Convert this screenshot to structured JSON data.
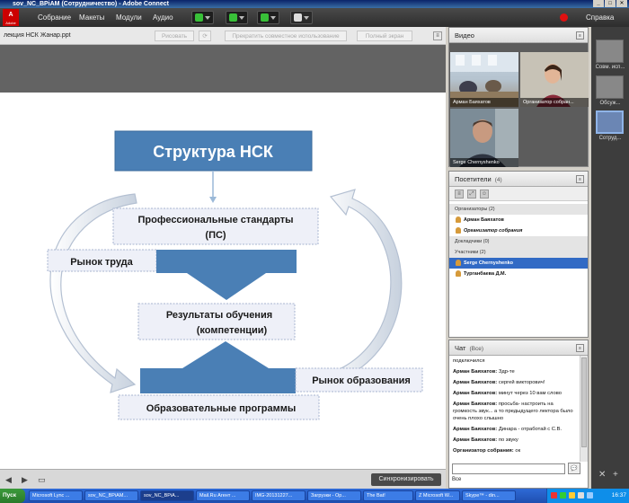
{
  "window": {
    "title": "sov_NC_BPiAM (Сотрудничество) - Adobe Connect"
  },
  "menubar": {
    "logo_text": "Adobe",
    "items": [
      "Собрание",
      "Макеты",
      "Модули",
      "Аудио"
    ],
    "help": "Справка"
  },
  "share_pod": {
    "title": "лекция НСК Жанар.ppt",
    "buttons": {
      "draw": "Рисовать",
      "stop_sharing": "Прекратить совместное использование",
      "fullscreen": "Полный экран"
    },
    "sync_button": "Синхронизировать"
  },
  "slide": {
    "title": "Структура НСК",
    "prof_standards_line1": "Профессиональные стандарты",
    "prof_standards_line2": "(ПС)",
    "labor_market": "Рынок труда",
    "outcomes_line1": "Результаты обучения",
    "outcomes_line2": "(компетенции)",
    "education_market": "Рынок образования",
    "programs": "Образовательные программы"
  },
  "video_pod": {
    "title": "Видео",
    "tiles": [
      {
        "label": "Арман Баяхатов"
      },
      {
        "label": "Организатор собран..."
      },
      {
        "label": "Serge Chernyshenko"
      }
    ]
  },
  "attendees_pod": {
    "title": "Посетители",
    "count": "(4)",
    "rows": [
      {
        "text": "Организаторы (2)",
        "type": "group"
      },
      {
        "text": "Арман Баяхатов",
        "type": "person"
      },
      {
        "text": "Организатор собрания",
        "type": "person-italic"
      },
      {
        "text": "Докладчики (0)",
        "type": "group"
      },
      {
        "text": "Участники (2)",
        "type": "group"
      },
      {
        "text": "Serge Chernyshenko",
        "type": "selected"
      },
      {
        "text": "Турганбаева Д.М.",
        "type": "person"
      }
    ]
  },
  "chat_pod": {
    "title": "Чат",
    "scope": "(Все)",
    "messages": [
      {
        "author": "",
        "text": "подключился"
      },
      {
        "author": "Арман Баяхатов:",
        "text": " Здр-те"
      },
      {
        "author": "Арман Баяхатов:",
        "text": " сергей викторович!"
      },
      {
        "author": "Арман Баяхатов:",
        "text": " минут через 10 вам слово"
      },
      {
        "author": "Арман Баяхатов:",
        "text": " просьба- настроить на громкость звук... а то предыдущего лектора было очень плохо слышно"
      },
      {
        "author": "Арман Баяхатов:",
        "text": " Динара - отработай с С.В."
      },
      {
        "author": "Арман Баяхатов:",
        "text": " по звуку"
      },
      {
        "author": "Организатор собрания:",
        "text": " ок"
      }
    ],
    "recipient": "Все"
  },
  "layouts": {
    "items": [
      "Совм. исп...",
      "Обсуж...",
      "Сотруд..."
    ]
  },
  "taskbar": {
    "start": "Пуск",
    "buttons": [
      "Microsoft Lync ...",
      "sov_NC_BPiAM...",
      "sov_NC_BPiA...",
      "Mail.Ru Агент ...",
      "IMG-20131227...",
      "Загрузки - Op...",
      "The Bat!",
      "Z Microsoft W...",
      "Skype™ - din..."
    ],
    "clock": "16:37"
  },
  "colors": {
    "slide_blue": "#4a7fb5",
    "box_fill": "#eef0f8",
    "record": "#e01010",
    "selected_row": "#316ac5"
  }
}
